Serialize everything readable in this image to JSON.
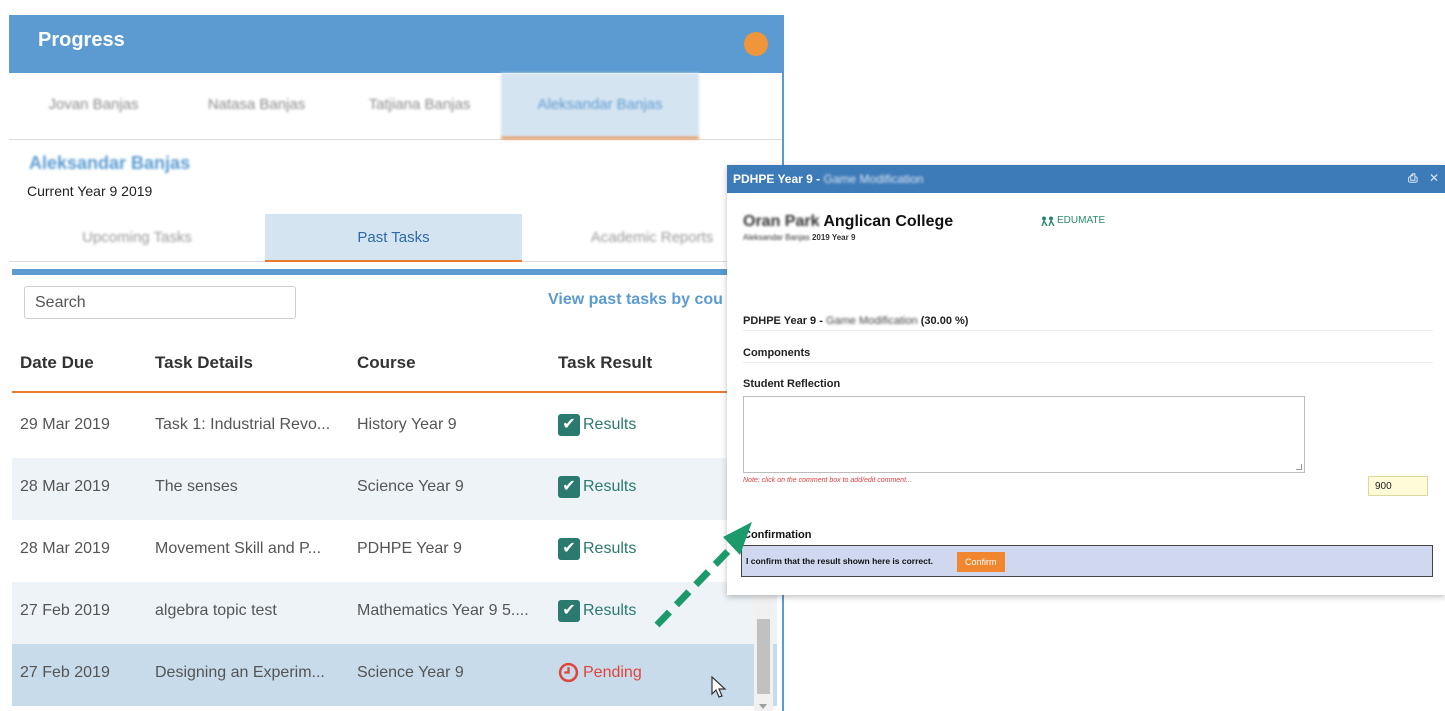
{
  "panel": {
    "title": "Progress",
    "student_tabs": [
      "Jovan Banjas",
      "Natasa Banjas",
      "Tatjiana Banjas",
      "Aleksandar Banjas"
    ],
    "student_name": "Aleksandar Banjas",
    "student_year": "Current Year 9 2019",
    "section_tabs": [
      "Upcoming Tasks",
      "Past Tasks",
      "Academic Reports"
    ],
    "search_placeholder": "Search",
    "view_link": "View past tasks by cou",
    "columns": [
      "Date Due",
      "Task Details",
      "Course",
      "Task Result"
    ],
    "rows": [
      {
        "date": "29 Mar 2019",
        "task": "Task 1: Industrial Revo...",
        "course": "History Year 9",
        "result": "Results",
        "status": "done"
      },
      {
        "date": "28 Mar 2019",
        "task": "The senses",
        "course": "Science Year 9",
        "result": "Results",
        "status": "done"
      },
      {
        "date": "28 Mar 2019",
        "task": "Movement Skill and P...",
        "course": "PDHPE Year 9",
        "result": "Results",
        "status": "done"
      },
      {
        "date": "27 Feb 2019",
        "task": "algebra topic test",
        "course": "Mathematics Year 9 5....",
        "result": "Results",
        "status": "done"
      },
      {
        "date": "27 Feb 2019",
        "task": "Designing an Experim...",
        "course": "Science Year 9",
        "result": "Pending",
        "status": "pending"
      }
    ],
    "colors": {
      "accent": "#5b9bd1",
      "tab_underline": "#e87b2f",
      "result_green": "#2a7a6f",
      "pending_red": "#e0453a"
    }
  },
  "popup": {
    "title": "PDHPE Year 9 -",
    "title_blurred": "Game Modification",
    "school_blurred": "Oran Park",
    "school_name": "Anglican College",
    "student_blurred": "Aleksandar Banjas",
    "student_year": "2019 Year 9",
    "logo_text": "EDUMATE",
    "course_line": "PDHPE Year 9 -",
    "course_blurred": "Game Modification",
    "weight": "(30.00 %)",
    "components_label": "Components",
    "reflection_label": "Student Reflection",
    "note": "Note: click on the comment box to add/edit comment...",
    "score": "900",
    "confirmation_label": "Confirmation",
    "confirm_text": "I confirm that the result shown here is correct.",
    "confirm_button": "Confirm",
    "icons": [
      "print-icon",
      "close-icon"
    ]
  },
  "annotation": {
    "arrow_color": "#1d9a6c"
  }
}
